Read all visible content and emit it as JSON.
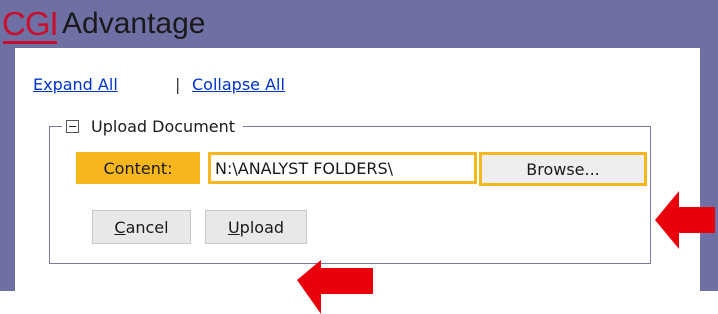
{
  "header": {
    "logo_text": "CGI",
    "app_name": "Advantage"
  },
  "links": {
    "expand_all": "Expand All",
    "separator": "|",
    "collapse_all": "Collapse All"
  },
  "upload_section": {
    "title": "Upload Document",
    "content_label": "Content:",
    "file_path_value": "N:\\ANALYST FOLDERS\\",
    "browse_label": "Browse...",
    "cancel_label": "Cancel",
    "upload_label": "Upload"
  },
  "colors": {
    "header_bg": "#6e6fa3",
    "logo_red": "#c8102e",
    "highlight_yellow": "#f5b71d",
    "arrow_red": "#e8000b",
    "link_blue": "#0033cc"
  },
  "icons": {
    "collapse_toggle": "minus-box-icon",
    "annotation_arrows": [
      "red-arrow-icon",
      "red-arrow-icon"
    ]
  }
}
